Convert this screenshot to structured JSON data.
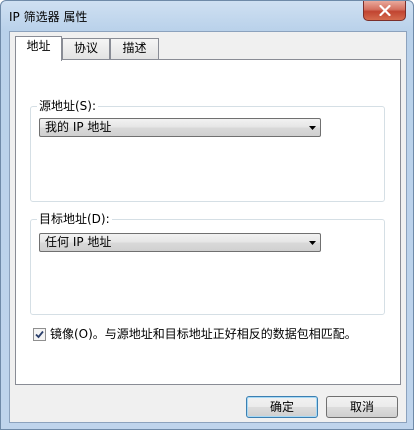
{
  "window": {
    "title": "IP 筛选器 属性",
    "close_icon": "close-icon"
  },
  "tabs": [
    {
      "label": "地址",
      "active": true
    },
    {
      "label": "协议",
      "active": false
    },
    {
      "label": "描述",
      "active": false
    }
  ],
  "source": {
    "label": "源地址(S):",
    "selected": "我的 IP 地址"
  },
  "destination": {
    "label": "目标地址(D):",
    "selected": "任何 IP 地址"
  },
  "mirror": {
    "checked": true,
    "label": "镜像(O)。与源地址和目标地址正好相反的数据包相匹配。"
  },
  "buttons": {
    "ok": "确定",
    "cancel": "取消"
  }
}
